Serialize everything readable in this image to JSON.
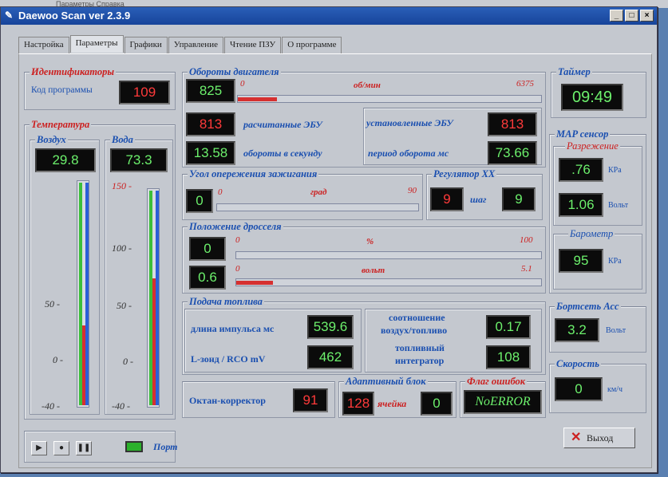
{
  "desktop_menu": "Параметры  Справка",
  "window": {
    "title": "Daewoo Scan ver 2.3.9",
    "buttons": [
      "_",
      "□",
      "×"
    ]
  },
  "tabs": [
    "Настройка",
    "Параметры",
    "Графики",
    "Управление",
    "Чтение ПЗУ",
    "О программе"
  ],
  "ident": {
    "title": "Идентификаторы",
    "label": "Код программы",
    "value": "109"
  },
  "temp": {
    "title": "Температура",
    "air_label": "Воздух",
    "air_value": "29.8",
    "water_label": "Вода",
    "water_value": "73.3",
    "scale_left": [
      "50 -",
      "0 -",
      "-40 -"
    ],
    "scale_right": [
      "150 -",
      "100 -",
      "50 -",
      "0 -",
      "-40 -"
    ],
    "air_level": 0.36,
    "water_level": 0.59
  },
  "rpm": {
    "title": "Обороты двигателя",
    "value": "825",
    "min": "0",
    "unit": "об/мин",
    "max": "6375",
    "level": 0.13,
    "calc_value": "813",
    "calc_label": "расчитанные ЭБУ",
    "set_label": "установленные ЭБУ",
    "set_value": "813",
    "rps_value": "13.58",
    "rps_label": "обороты в секунду",
    "period_label": "период оборота мс",
    "period_value": "73.66"
  },
  "timer": {
    "title": "Таймер",
    "value": "09:49"
  },
  "map": {
    "title": "MAP сенсор",
    "vac_title": "Разрежение",
    "kpa_value": ".76",
    "kpa_unit": "КPa",
    "volt_value": "1.06",
    "volt_unit": "Вольт",
    "baro_title": "Барометр",
    "baro_value": "95",
    "baro_unit": "КPa"
  },
  "ignition": {
    "title": "Угол опережения зажигания",
    "value": "0",
    "min": "0",
    "unit": "град",
    "max": "90",
    "level": 0.0
  },
  "idle": {
    "title": "Регулятор ХХ",
    "value": "9",
    "label": "шаг",
    "step_value": "9"
  },
  "throttle": {
    "title": "Положение дросселя",
    "pct_value": "0",
    "pct_min": "0",
    "pct_unit": "%",
    "pct_max": "100",
    "pct_level": 0.0,
    "volt_value": "0.6",
    "volt_min": "0",
    "volt_unit": "вольт",
    "volt_max": "5.1",
    "volt_level": 0.12
  },
  "fuel": {
    "title": "Подача топлива",
    "pulse_label": "длина импульса  мс",
    "pulse_value": "539.6",
    "ratio_label_1": "соотношение",
    "ratio_label_2": "воздух/топливо",
    "ratio_value": "0.17",
    "lambda_label": "L-зонд / RCO  mV",
    "lambda_value": "462",
    "integr_label_1": "топливный",
    "integr_label_2": "интегратор",
    "integr_value": "108"
  },
  "board": {
    "title": "Бортсеть Асс",
    "value": "3.2",
    "unit": "Вольт"
  },
  "speed": {
    "title": "Скорость",
    "value": "0",
    "unit": "км/ч"
  },
  "octane": {
    "label": "Октан-корректор",
    "value": "91"
  },
  "adaptive": {
    "title": "Адаптивный блок",
    "value": "128",
    "cell_label": "ячейка",
    "cell_value": "0"
  },
  "errors": {
    "title": "Флаг ошибок",
    "value": "NoERROR"
  },
  "port_label": "Порт",
  "exit_label": "Выход",
  "colors": {
    "accent_blue": "#1a4fb0",
    "accent_red": "#cc2020",
    "lcd_green": "#6cf06c",
    "lcd_red": "#ff3a3a"
  }
}
